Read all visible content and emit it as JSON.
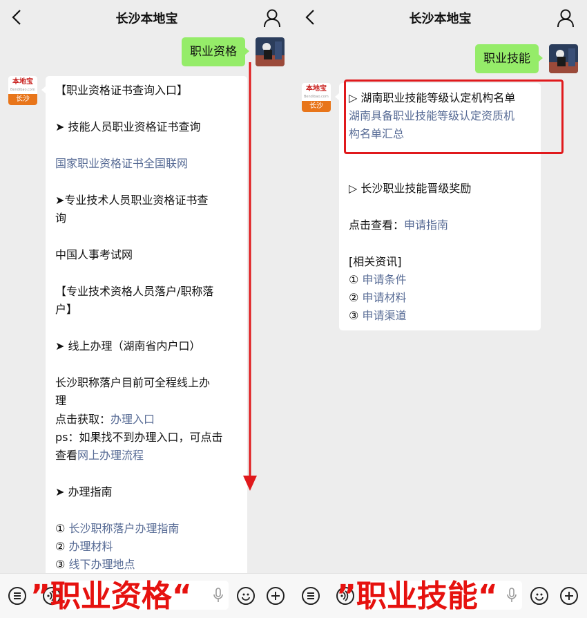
{
  "app_title": "长沙本地宝",
  "logo": {
    "brand": "本地宝",
    "site": "Bendibao.com",
    "city": "长沙"
  },
  "left": {
    "sent_message": "职业资格",
    "lines": [
      "【职业资格证书查询入口】",
      "➤ 技能人员职业资格证书查询",
      "国家职业资格证书全国联网",
      "➤专业技术人员职业资格证书查",
      "询",
      "中国人事考试网",
      "【专业技术资格人员落户/职称落",
      "户】",
      "➤ 线上办理（湖南省内户口）",
      "长沙职称落户目前可全程线上办",
      "理",
      "点击获取：",
      "办理入口",
      "ps：如果找不到办理入口，可点击",
      "查看",
      "网上办理流程",
      "➤ 办理指南",
      "① ",
      "长沙职称落户办理指南",
      "② ",
      "办理材料",
      "③ ",
      "线下办理地点"
    ],
    "caption": "”职业资格“"
  },
  "right": {
    "sent_message": "职业技能",
    "lines": [
      "▷ 湖南职业技能等级认定机构名单",
      "湖南具备职业技能等级认定资质机",
      "构名单汇总",
      "▷ 长沙职业技能晋级奖励",
      "点击查看：",
      "申请指南",
      "[相关资讯]",
      "① ",
      "申请条件",
      "② ",
      "申请材料",
      "③ ",
      "申请渠道"
    ],
    "caption": "”职业技能“"
  },
  "colors": {
    "green_bubble": "#95ec69",
    "link": "#576b95",
    "annotation_red": "#e0191c",
    "logo_orange": "#e8751a"
  }
}
